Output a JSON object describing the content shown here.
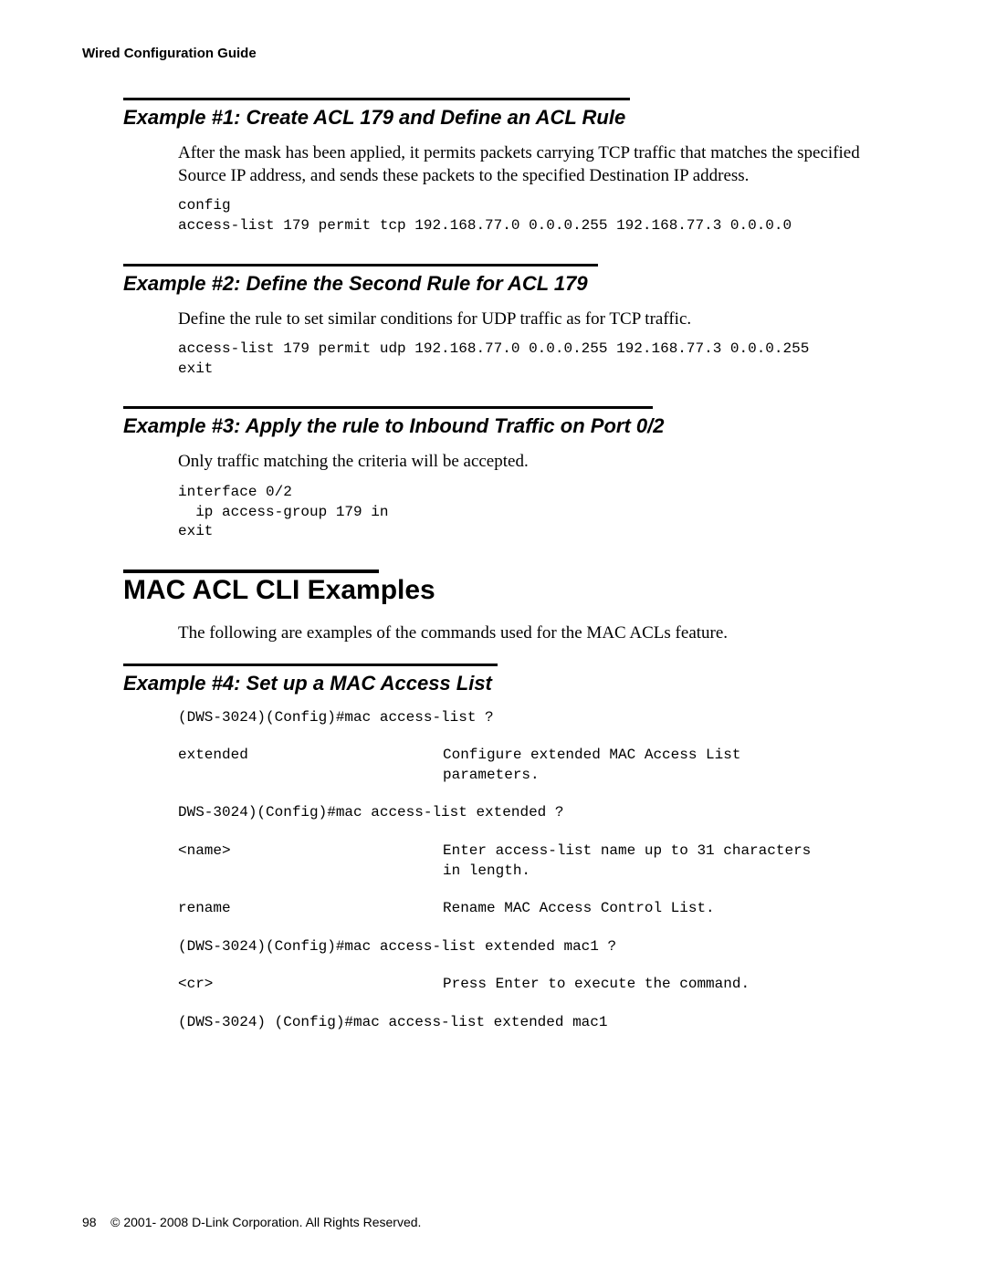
{
  "header": "Wired Configuration Guide",
  "ex1": {
    "title": "Example #1: Create ACL 179 and Define an ACL Rule",
    "para": "After the mask has been applied, it permits packets carrying TCP traffic that matches the specified Source IP address, and sends these packets to the specified Destination IP address.",
    "code": "config\naccess-list 179 permit tcp 192.168.77.0 0.0.0.255 192.168.77.3 0.0.0.0"
  },
  "ex2": {
    "title": "Example #2: Define the Second Rule for ACL 179",
    "para": "Define the rule to set similar conditions for UDP traffic as for TCP traffic.",
    "code": "access-list 179 permit udp 192.168.77.0 0.0.0.255 192.168.77.3 0.0.0.255\nexit"
  },
  "ex3": {
    "title": "Example #3: Apply the rule to Inbound Traffic on Port 0/2",
    "para": "Only traffic matching the criteria will be accepted.",
    "code": "interface 0/2\n  ip access-group 179 in\nexit"
  },
  "mac_section": {
    "title": "MAC ACL CLI Examples",
    "para": "The following are examples of the commands used for the MAC ACLs feature."
  },
  "ex4": {
    "title": "Example #4: Set up a MAC Access List",
    "lines": {
      "l1": "(DWS-3024)(Config)#mac access-list ?",
      "l2_left": "extended",
      "l2_right": "Configure extended MAC Access List parameters.",
      "l3": "DWS-3024)(Config)#mac access-list extended ?",
      "l4_left": "<name>",
      "l4_right": "Enter access-list name up to 31 characters in length.",
      "l5_left": "rename",
      "l5_right": "Rename MAC Access Control List.",
      "l6": "(DWS-3024)(Config)#mac access-list extended mac1 ?",
      "l7_left": "<cr>",
      "l7_right": "Press Enter to execute the command.",
      "l8": "(DWS-3024) (Config)#mac access-list extended mac1"
    }
  },
  "footer": {
    "page": "98",
    "copyright": "© 2001- 2008 D-Link Corporation. All Rights Reserved."
  }
}
